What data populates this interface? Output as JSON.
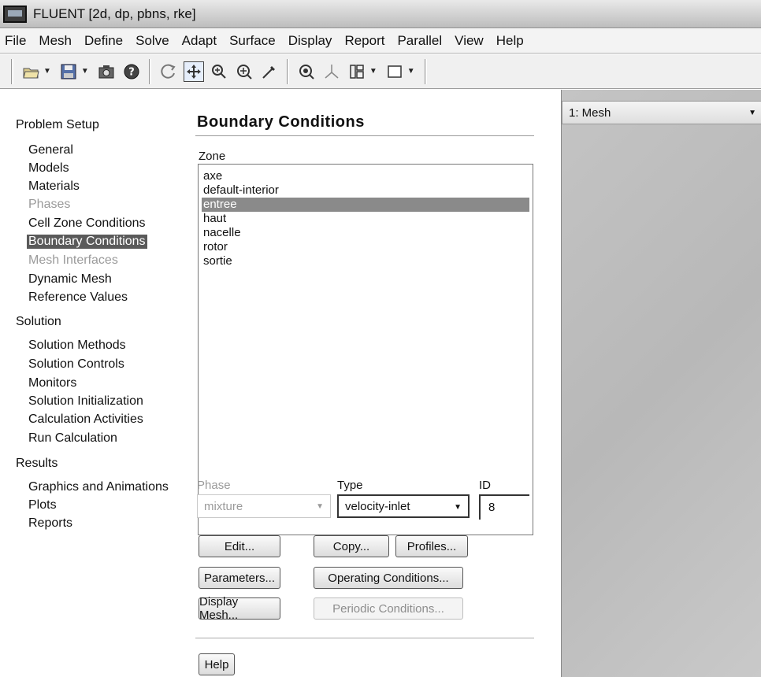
{
  "window": {
    "title": "FLUENT  [2d, dp, pbns, rke]"
  },
  "menu": [
    "File",
    "Mesh",
    "Define",
    "Solve",
    "Adapt",
    "Surface",
    "Display",
    "Report",
    "Parallel",
    "View",
    "Help"
  ],
  "toolbar": {
    "icons": [
      "open-file-icon",
      "save-icon",
      "camera-icon",
      "help-icon",
      "rotate-icon",
      "pan-icon",
      "zoom-in-icon",
      "zoom-box-icon",
      "probe-icon",
      "fit-icon",
      "axes-icon",
      "layout-icon",
      "window-icon"
    ]
  },
  "nav": {
    "problem_setup": "Problem Setup",
    "setup_items": [
      "General",
      "Models",
      "Materials",
      "Phases",
      "Cell Zone Conditions",
      "Boundary Conditions",
      "Mesh Interfaces",
      "Dynamic Mesh",
      "Reference Values"
    ],
    "solution": "Solution",
    "solution_items": [
      "Solution Methods",
      "Solution Controls",
      "Monitors",
      "Solution Initialization",
      "Calculation Activities",
      "Run Calculation"
    ],
    "results": "Results",
    "results_items": [
      "Graphics and Animations",
      "Plots",
      "Reports"
    ]
  },
  "task": {
    "title": "Boundary Conditions",
    "zone_label": "Zone",
    "zones": [
      "axe",
      "default-interior",
      "entree",
      "haut",
      "nacelle",
      "rotor",
      "sortie"
    ],
    "selected_zone": "entree",
    "phase_label": "Phase",
    "phase_value": "mixture",
    "type_label": "Type",
    "type_value": "velocity-inlet",
    "id_label": "ID",
    "id_value": "8",
    "buttons": {
      "edit": "Edit...",
      "copy": "Copy...",
      "profiles": "Profiles...",
      "parameters": "Parameters...",
      "operating": "Operating Conditions...",
      "display_mesh": "Display Mesh...",
      "periodic": "Periodic Conditions...",
      "help": "Help"
    }
  },
  "graphics": {
    "window_label": "1: Mesh"
  }
}
